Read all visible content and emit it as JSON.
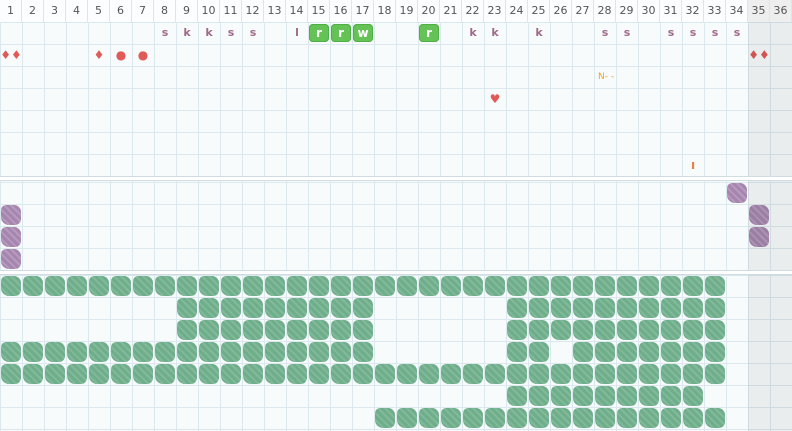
{
  "columns": [
    "1",
    "2",
    "3",
    "4",
    "5",
    "6",
    "7",
    "8",
    "9",
    "10",
    "11",
    "12",
    "13",
    "14",
    "15",
    "16",
    "17",
    "18",
    "19",
    "20",
    "21",
    "22",
    "23",
    "24",
    "25",
    "26",
    "27",
    "28",
    "29",
    "30",
    "31",
    "32",
    "33",
    "34",
    "35",
    "36"
  ],
  "shaded_columns": [
    35,
    36
  ],
  "letter_row": [
    {
      "col": 8,
      "text": "s"
    },
    {
      "col": 9,
      "text": "k"
    },
    {
      "col": 10,
      "text": "k"
    },
    {
      "col": 11,
      "text": "s"
    },
    {
      "col": 12,
      "text": "s"
    },
    {
      "col": 14,
      "text": "l"
    },
    {
      "col": 22,
      "text": "k"
    },
    {
      "col": 23,
      "text": "k"
    },
    {
      "col": 25,
      "text": "k"
    },
    {
      "col": 28,
      "text": "s"
    },
    {
      "col": 29,
      "text": "s"
    },
    {
      "col": 31,
      "text": "s"
    },
    {
      "col": 32,
      "text": "s"
    },
    {
      "col": 33,
      "text": "s"
    },
    {
      "col": 34,
      "text": "s"
    }
  ],
  "green_badges": [
    {
      "col": 15,
      "text": "r"
    },
    {
      "col": 16,
      "text": "r"
    },
    {
      "col": 17,
      "text": "w"
    },
    {
      "col": 20,
      "text": "r"
    }
  ],
  "red_marks": [
    {
      "col": 1,
      "row": 2,
      "symbol": "♦♦",
      "name": "double-drop-icon"
    },
    {
      "col": 5,
      "row": 2,
      "symbol": "♦",
      "name": "drop-icon"
    },
    {
      "col": 6,
      "row": 2,
      "symbol": "●",
      "name": "dot-icon"
    },
    {
      "col": 7,
      "row": 2,
      "symbol": "●",
      "name": "dot-icon"
    },
    {
      "col": 35,
      "row": 2,
      "symbol": "♦♦",
      "name": "double-drop-icon"
    },
    {
      "col": 23,
      "row": 4,
      "symbol": "♥",
      "name": "heart-icon"
    },
    {
      "col": 32,
      "row": 7,
      "symbol": "ı",
      "name": "tick-mark-icon"
    }
  ],
  "orange_label": {
    "col": 28,
    "row": 3,
    "text": "N- -"
  },
  "purple_blobs": [
    {
      "col": 34,
      "row": 0
    },
    {
      "col": 1,
      "row": 1
    },
    {
      "col": 35,
      "row": 1
    },
    {
      "col": 1,
      "row": 2
    },
    {
      "col": 35,
      "row": 2
    },
    {
      "col": 1,
      "row": 3
    }
  ],
  "green_rows": [
    [
      [
        1,
        33
      ]
    ],
    [
      [
        9,
        17
      ],
      [
        24,
        33
      ]
    ],
    [
      [
        9,
        17
      ],
      [
        24,
        33
      ]
    ],
    [
      [
        1,
        17
      ],
      [
        24,
        25
      ],
      [
        27,
        33
      ]
    ],
    [
      [
        1,
        33
      ]
    ],
    [
      [
        24,
        32
      ]
    ],
    [
      [
        18,
        33
      ]
    ]
  ],
  "colors": {
    "grid_line": "#dbe8ee",
    "background": "#f7fbfc",
    "letter": "#a06a88",
    "badge_green": "#64c257",
    "blob_green": "#6fae8b",
    "blob_purple": "#a685ae",
    "red": "#e05a57",
    "orange": "#f0a31d"
  }
}
